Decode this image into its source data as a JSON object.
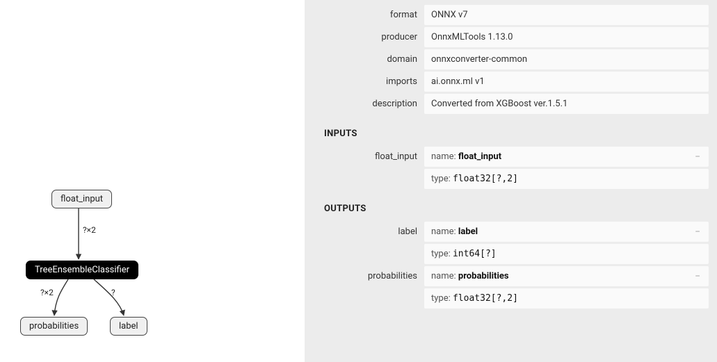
{
  "graph": {
    "nodes": {
      "input": "float_input",
      "op": "TreeEnsembleClassifier",
      "out_prob": "probabilities",
      "out_label": "label"
    },
    "edge_labels": {
      "input_op": "?×2",
      "op_prob": "?×2",
      "op_label": "?"
    }
  },
  "model": {
    "format": {
      "key": "format",
      "value": "ONNX v7"
    },
    "producer": {
      "key": "producer",
      "value": "OnnxMLTools 1.13.0"
    },
    "domain": {
      "key": "domain",
      "value": "onnxconverter-common"
    },
    "imports": {
      "key": "imports",
      "value": "ai.onnx.ml v1"
    },
    "description": {
      "key": "description",
      "value": "Converted from XGBoost ver.1.5.1"
    }
  },
  "sections": {
    "inputs": "INPUTS",
    "outputs": "OUTPUTS"
  },
  "labels": {
    "name": "name: ",
    "type": "type: "
  },
  "inputs": {
    "float_input": {
      "key": "float_input",
      "name": "float_input",
      "type": "float32[?,2]"
    }
  },
  "outputs": {
    "label": {
      "key": "label",
      "name": "label",
      "type": "int64[?]"
    },
    "probabilities": {
      "key": "probabilities",
      "name": "probabilities",
      "type": "float32[?,2]"
    }
  }
}
